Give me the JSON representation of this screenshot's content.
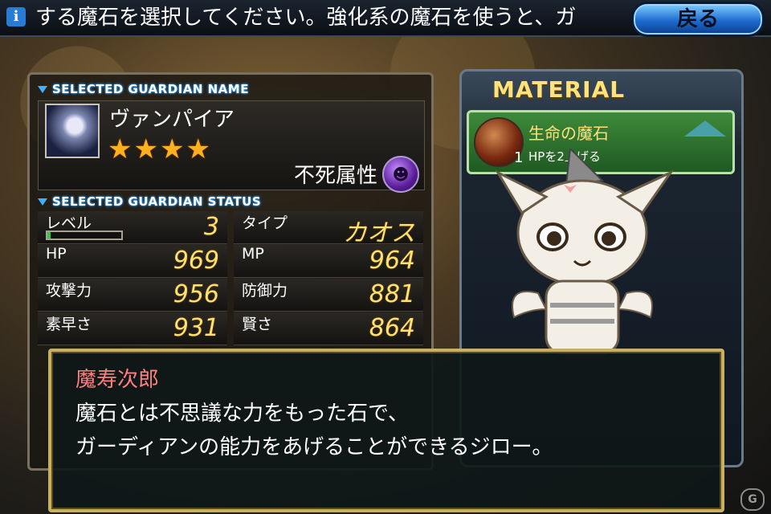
{
  "topbar": {
    "info_icon": "info-icon",
    "ticker_text": "する魔石を選択してください。強化系の魔石を使うと、ガ",
    "back_label": "戻る"
  },
  "guardian": {
    "name_header": "SELECTED GUARDIAN NAME",
    "name": "ヴァンパイア",
    "stars": "★★★★",
    "star_count": 4,
    "attribute": "不死属性",
    "status_header": "SELECTED GUARDIAN STATUS",
    "stats": {
      "level": {
        "label": "レベル",
        "value": "3"
      },
      "type": {
        "label": "タイプ",
        "value": "カオス"
      },
      "hp": {
        "label": "HP",
        "value": "969"
      },
      "mp": {
        "label": "MP",
        "value": "964"
      },
      "atk": {
        "label": "攻撃力",
        "value": "956"
      },
      "def": {
        "label": "防御力",
        "value": "881"
      },
      "spd": {
        "label": "素早さ",
        "value": "931"
      },
      "int": {
        "label": "賢さ",
        "value": "864"
      }
    },
    "level_progress": 0.04
  },
  "material": {
    "title": "MATERIAL",
    "item": {
      "name": "生命の魔石",
      "quantity": "1",
      "description": "HPを2上げる"
    }
  },
  "dialog": {
    "speaker": "魔寿次郎",
    "line1": "魔石とは不思議な力をもった石で、",
    "line2": "ガーディアンの能力をあげることができるジロー。"
  },
  "colors": {
    "speaker": "#ff7f7f",
    "stat_value": "#ffe070",
    "material_title": "#ffe27a",
    "header_glow": "#2aa0ff"
  }
}
